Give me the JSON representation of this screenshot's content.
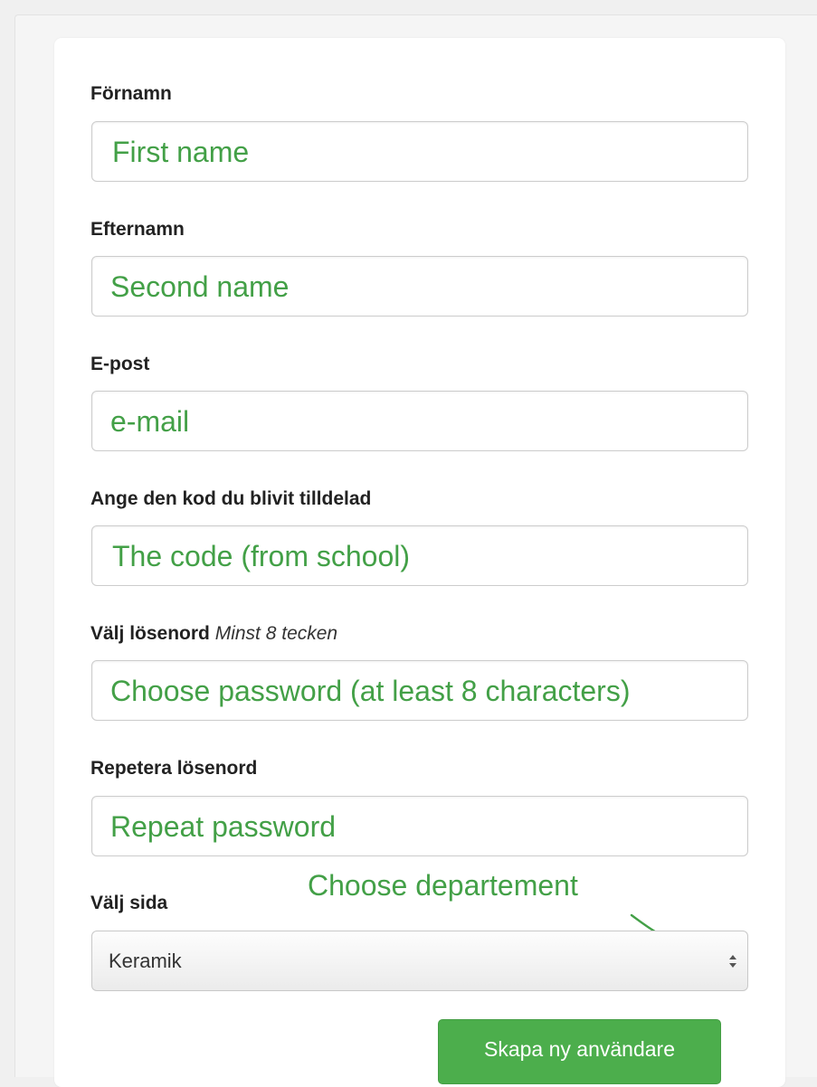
{
  "form": {
    "fields": [
      {
        "label": "Förnamn",
        "annotation": "First name"
      },
      {
        "label": "Efternamn",
        "annotation": "Second name"
      },
      {
        "label": "E-post",
        "annotation": "e-mail"
      },
      {
        "label": "Ange den kod du blivit tilldelad",
        "annotation": "The code (from school)"
      },
      {
        "label": "Välj lösenord",
        "hint": "Minst 8 tecken",
        "annotation": "Choose password (at least 8 characters)"
      },
      {
        "label": "Repetera lösenord",
        "annotation": "Repeat password"
      }
    ],
    "department": {
      "label": "Välj sida",
      "annotation": "Choose departement",
      "selected": "Keramik"
    },
    "submit_label": "Skapa ny användare"
  },
  "colors": {
    "annotation": "#43a047",
    "submit": "#4cae4c"
  },
  "icons": {
    "select_arrows": "select-up-down-arrows-icon",
    "annotation_arrow": "annotation-arrow-icon"
  }
}
